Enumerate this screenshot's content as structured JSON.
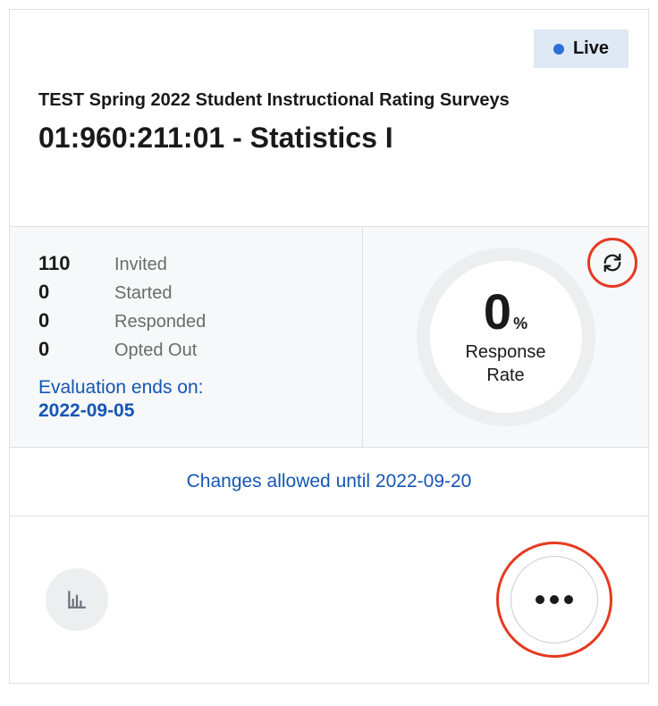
{
  "status": {
    "label": "Live",
    "color": "#2d6fd6"
  },
  "header": {
    "subtitle": "TEST Spring 2022 Student Instructional Rating Surveys",
    "title": "01:960:211:01 - Statistics I"
  },
  "stats": {
    "invited": {
      "value": "110",
      "label": "Invited"
    },
    "started": {
      "value": "0",
      "label": "Started"
    },
    "responded": {
      "value": "0",
      "label": "Responded"
    },
    "opted_out": {
      "value": "0",
      "label": "Opted Out"
    }
  },
  "evaluation": {
    "ends_label": "Evaluation ends on:",
    "ends_date": "2022-09-05"
  },
  "response_rate": {
    "value": "0",
    "pct_symbol": "%",
    "label_line1": "Response",
    "label_line2": "Rate"
  },
  "changes": {
    "text": "Changes allowed until 2022-09-20"
  },
  "icons": {
    "refresh": "refresh-icon",
    "chart": "bar-chart-icon",
    "more": "more-icon"
  }
}
